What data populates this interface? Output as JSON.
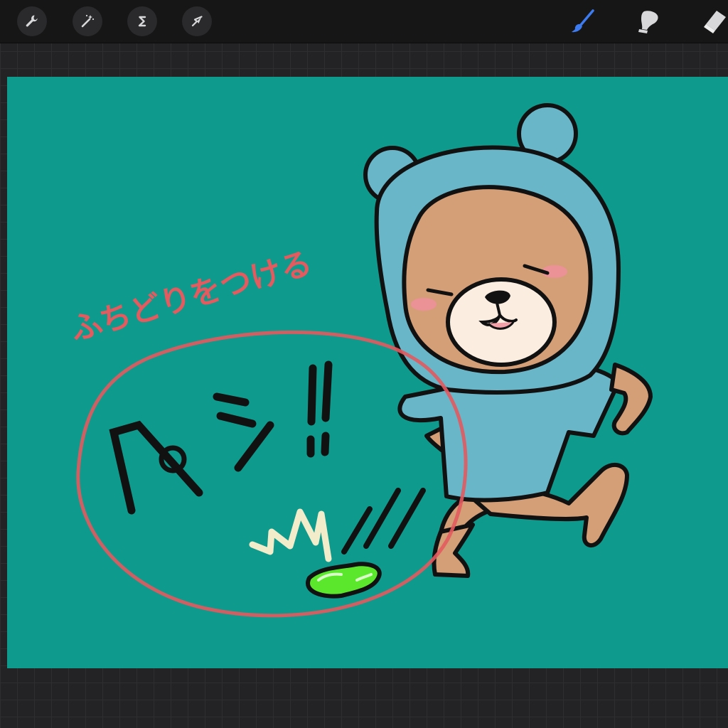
{
  "toolbar": {
    "left_tools": [
      {
        "name": "actions",
        "icon": "wrench-icon"
      },
      {
        "name": "adjustments",
        "icon": "magic-wand-icon"
      },
      {
        "name": "selection",
        "icon": "selection-s-icon"
      },
      {
        "name": "transform",
        "icon": "arrow-cursor-icon"
      }
    ],
    "right_tools": [
      {
        "name": "brush",
        "icon": "brush-icon",
        "active": true
      },
      {
        "name": "smudge",
        "icon": "smudge-finger-icon",
        "active": false
      },
      {
        "name": "eraser",
        "icon": "eraser-icon",
        "active": false
      }
    ]
  },
  "canvas": {
    "annotation_text": "ふちどりをつける",
    "sfx_text": "ペシッ!!"
  },
  "colors": {
    "ui_background": "#232325",
    "toolbar_background": "#161617",
    "canvas_background": "#0e9a8c",
    "active_tool": "#3d7bf0",
    "annotation": "#e35a5f",
    "bear_hood": "#69b6c9",
    "bear_fur": "#d49e76",
    "bear_muzzle": "#fbede0",
    "gum": "#5be82c"
  }
}
